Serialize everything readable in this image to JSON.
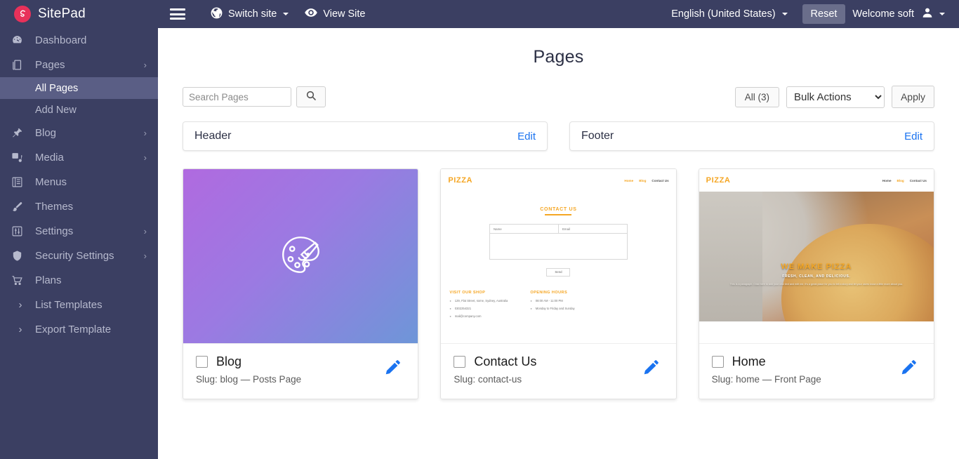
{
  "topbar": {
    "brand_logo_glyph": "S",
    "brand_name": "SitePad",
    "menu_icon": "hamburger-icon",
    "switch_site_label": "Switch site",
    "view_site_label": "View Site",
    "language_label": "English (United States)",
    "reset_label": "Reset",
    "welcome_label": "Welcome soft"
  },
  "sidebar": {
    "items": [
      {
        "label": "Dashboard",
        "icon": "dashboard-icon",
        "has_chevron": false
      },
      {
        "label": "Pages",
        "icon": "pages-icon",
        "has_chevron": true
      },
      {
        "label": "Blog",
        "icon": "pin-icon",
        "has_chevron": true
      },
      {
        "label": "Media",
        "icon": "media-icon",
        "has_chevron": true
      },
      {
        "label": "Menus",
        "icon": "menus-icon",
        "has_chevron": false
      },
      {
        "label": "Themes",
        "icon": "brush-icon",
        "has_chevron": false
      },
      {
        "label": "Settings",
        "icon": "sliders-icon",
        "has_chevron": true
      },
      {
        "label": "Security Settings",
        "icon": "shield-icon",
        "has_chevron": true
      },
      {
        "label": "Plans",
        "icon": "cart-icon",
        "has_chevron": false
      },
      {
        "label": "List Templates",
        "icon": "chevron-right-icon",
        "has_chevron": false
      },
      {
        "label": "Export Template",
        "icon": "chevron-right-icon",
        "has_chevron": false
      }
    ],
    "sub_items": [
      {
        "label": "All Pages",
        "active": true
      },
      {
        "label": "Add New",
        "active": false
      }
    ]
  },
  "main": {
    "page_title": "Pages",
    "search": {
      "placeholder": "Search Pages",
      "value": "",
      "button_icon": "search-icon"
    },
    "filters": {
      "all_label": "All (3)",
      "bulk_actions_label": "Bulk Actions",
      "bulk_actions_options": [
        "Bulk Actions"
      ],
      "apply_label": "Apply"
    },
    "special_pages": [
      {
        "title": "Header",
        "edit_label": "Edit"
      },
      {
        "title": "Footer",
        "edit_label": "Edit"
      }
    ],
    "cards": [
      {
        "title": "Blog",
        "slug_text": "Slug: blog — Posts Page",
        "checked": false,
        "edit_icon": "pencil-icon",
        "thumb_type": "gradient",
        "thumb_icon": "palette-icon"
      },
      {
        "title": "Contact Us",
        "slug_text": "Slug: contact-us",
        "checked": false,
        "edit_icon": "pencil-icon",
        "thumb_type": "contact-preview",
        "preview": {
          "logo": "PIZZA",
          "nav": [
            "Home",
            "Blog",
            "Contact Us"
          ],
          "heading": "CONTACT US",
          "field_name": "Name",
          "field_email": "Email",
          "send_label": "Send",
          "footer_col1_head": "VISIT OUR SHOP",
          "footer_col1_lines": [
            "129, Flat Street, some, Sydney, Australia",
            "0302254321",
            "mail@company.com"
          ],
          "footer_col2_head": "OPENING HOURS",
          "footer_col2_lines": [
            "08:00 AM - 11:00 PM",
            "Monday to Friday and Sunday"
          ]
        }
      },
      {
        "title": "Home",
        "slug_text": "Slug: home — Front Page",
        "checked": false,
        "edit_icon": "pencil-icon",
        "thumb_type": "home-preview",
        "preview": {
          "logo": "PIZZA",
          "nav": [
            "Home",
            "Blog",
            "Contact Us"
          ],
          "hero_heading": "WE MAKE PIZZA",
          "hero_sub": "FRESH, CLEAN, AND DELICIOUS.",
          "hero_paragraph": "This is a paragraph. Click here to add your own text and edit me. It's a great place for you to tell a story and let your users know a little more about you."
        }
      }
    ]
  },
  "colors": {
    "sidebar_bg": "#3b3f62",
    "sidebar_active": "#5a5e85",
    "brand_red": "#e8315a",
    "link_blue": "#1a73f0",
    "accent_orange": "#f5a623"
  }
}
